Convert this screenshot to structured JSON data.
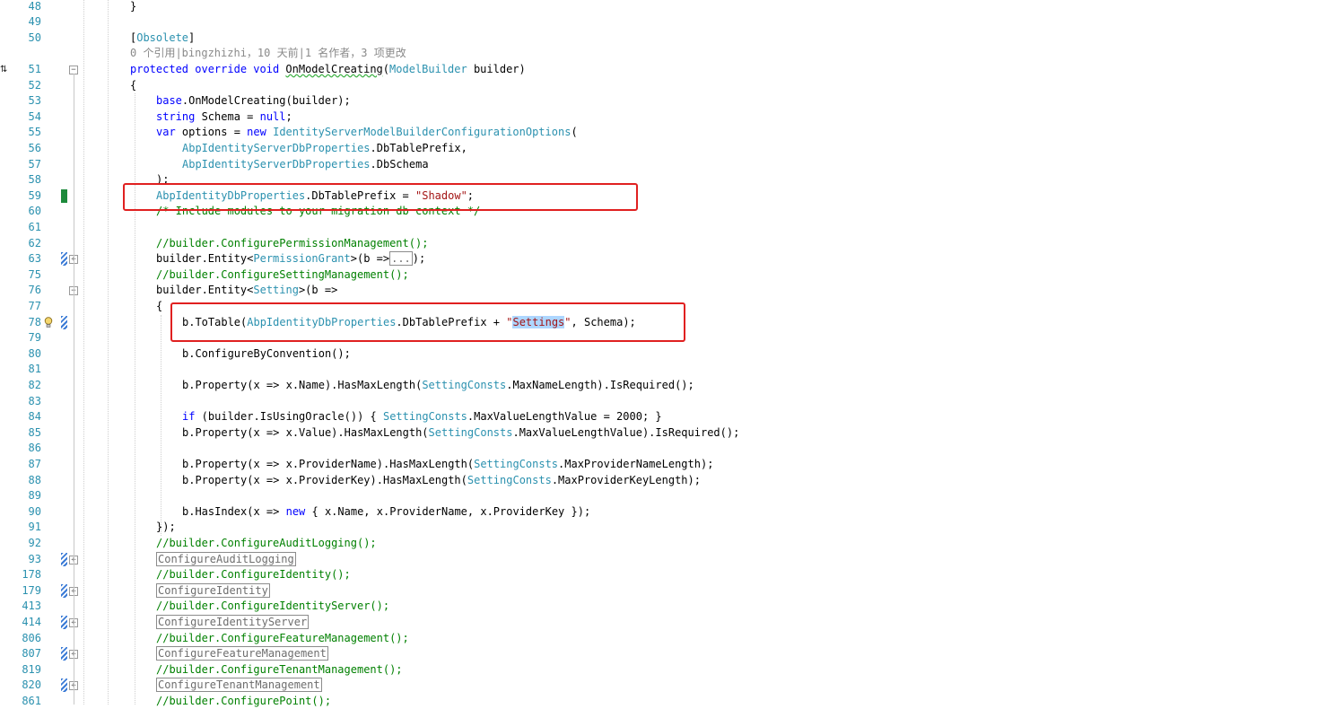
{
  "editor": {
    "language": "C#",
    "margin_marker": "⇅",
    "lines": [
      {
        "num": "48",
        "segs": [
          {
            "t": "}"
          }
        ],
        "indent": 0
      },
      {
        "num": "49",
        "segs": [],
        "indent": 0
      },
      {
        "num": "50",
        "segs": [
          {
            "t": "["
          },
          {
            "t": "Obsolete",
            "c": "att"
          },
          {
            "t": "]"
          }
        ],
        "indent": 0
      },
      {
        "num": "",
        "segs": [
          {
            "t": "0 个引用|bingzhizhi，10 天前|1 名作者，3 项更改",
            "c": "lens"
          }
        ],
        "indent": 0,
        "lens": true
      },
      {
        "num": "51",
        "segs": [
          {
            "t": "protected override void",
            "c": "kw"
          },
          {
            "t": " "
          },
          {
            "t": "OnModelCreating",
            "c": "wavy"
          },
          {
            "t": "("
          },
          {
            "t": "ModelBuilder",
            "c": "ty"
          },
          {
            "t": " builder)"
          }
        ],
        "indent": 0,
        "fold": "minus"
      },
      {
        "num": "52",
        "segs": [
          {
            "t": "{"
          }
        ],
        "indent": 0
      },
      {
        "num": "53",
        "segs": [
          {
            "t": "base",
            "c": "kw"
          },
          {
            "t": ".OnModelCreating(builder);"
          }
        ],
        "indent": 1
      },
      {
        "num": "54",
        "segs": [
          {
            "t": "string",
            "c": "kw"
          },
          {
            "t": " Schema = "
          },
          {
            "t": "null",
            "c": "kw"
          },
          {
            "t": ";"
          }
        ],
        "indent": 1
      },
      {
        "num": "55",
        "segs": [
          {
            "t": "var",
            "c": "kw"
          },
          {
            "t": " options = "
          },
          {
            "t": "new",
            "c": "kw"
          },
          {
            "t": " "
          },
          {
            "t": "IdentityServerModelBuilderConfigurationOptions",
            "c": "ty"
          },
          {
            "t": "("
          }
        ],
        "indent": 1
      },
      {
        "num": "56",
        "segs": [
          {
            "t": "AbpIdentityServerDbProperties",
            "c": "ty"
          },
          {
            "t": ".DbTablePrefix,"
          }
        ],
        "indent": 2
      },
      {
        "num": "57",
        "segs": [
          {
            "t": "AbpIdentityServerDbProperties",
            "c": "ty"
          },
          {
            "t": ".DbSchema"
          }
        ],
        "indent": 2
      },
      {
        "num": "58",
        "segs": [
          {
            "t": ");"
          }
        ],
        "indent": 1
      },
      {
        "num": "59",
        "segs": [
          {
            "t": "AbpIdentityDbProperties",
            "c": "ty"
          },
          {
            "t": ".DbTablePrefix = "
          },
          {
            "t": "\"Shadow\"",
            "c": "st"
          },
          {
            "t": ";"
          }
        ],
        "indent": 1,
        "gutter": "saved"
      },
      {
        "num": "60",
        "segs": [
          {
            "t": "/* Include modules to your migration db context */",
            "c": "cm"
          }
        ],
        "indent": 1
      },
      {
        "num": "61",
        "segs": [],
        "indent": 0
      },
      {
        "num": "62",
        "segs": [
          {
            "t": "//builder.ConfigurePermissionManagement();",
            "c": "cm"
          }
        ],
        "indent": 1
      },
      {
        "num": "63",
        "segs": [
          {
            "t": "builder.Entity<"
          },
          {
            "t": "PermissionGrant",
            "c": "ty"
          },
          {
            "t": ">(b =>"
          },
          {
            "t": "...",
            "c": "coll"
          },
          {
            "t": ");"
          }
        ],
        "indent": 1,
        "fold": "plus",
        "gutter": "chg"
      },
      {
        "num": "75",
        "segs": [
          {
            "t": "//builder.ConfigureSettingManagement();",
            "c": "cm"
          }
        ],
        "indent": 1
      },
      {
        "num": "76",
        "segs": [
          {
            "t": "builder.Entity<"
          },
          {
            "t": "Setting",
            "c": "ty"
          },
          {
            "t": ">(b =>"
          }
        ],
        "indent": 1,
        "fold": "minus"
      },
      {
        "num": "77",
        "segs": [
          {
            "t": "{"
          }
        ],
        "indent": 1
      },
      {
        "num": "78",
        "segs": [
          {
            "t": "b.ToTable("
          },
          {
            "t": "AbpIdentityDbProperties",
            "c": "ty"
          },
          {
            "t": ".DbTablePrefix + "
          },
          {
            "t": "\"",
            "c": "st"
          },
          {
            "t": "Settings",
            "c": "st hl"
          },
          {
            "t": "\"",
            "c": "st"
          },
          {
            "t": ", Schema);"
          }
        ],
        "indent": 2,
        "gutter": "chg",
        "bulb": true
      },
      {
        "num": "79",
        "segs": [],
        "indent": 0
      },
      {
        "num": "80",
        "segs": [
          {
            "t": "b.ConfigureByConvention();"
          }
        ],
        "indent": 2
      },
      {
        "num": "81",
        "segs": [],
        "indent": 0
      },
      {
        "num": "82",
        "segs": [
          {
            "t": "b.Property(x => x.Name).HasMaxLength("
          },
          {
            "t": "SettingConsts",
            "c": "ty"
          },
          {
            "t": ".MaxNameLength).IsRequired();"
          }
        ],
        "indent": 2
      },
      {
        "num": "83",
        "segs": [],
        "indent": 0
      },
      {
        "num": "84",
        "segs": [
          {
            "t": "if",
            "c": "kw"
          },
          {
            "t": " (builder.IsUsingOracle()) { "
          },
          {
            "t": "SettingConsts",
            "c": "ty"
          },
          {
            "t": ".MaxValueLengthValue = 2000; }"
          }
        ],
        "indent": 2
      },
      {
        "num": "85",
        "segs": [
          {
            "t": "b.Property(x => x.Value).HasMaxLength("
          },
          {
            "t": "SettingConsts",
            "c": "ty"
          },
          {
            "t": ".MaxValueLengthValue).IsRequired();"
          }
        ],
        "indent": 2
      },
      {
        "num": "86",
        "segs": [],
        "indent": 0
      },
      {
        "num": "87",
        "segs": [
          {
            "t": "b.Property(x => x.ProviderName).HasMaxLength("
          },
          {
            "t": "SettingConsts",
            "c": "ty"
          },
          {
            "t": ".MaxProviderNameLength);"
          }
        ],
        "indent": 2
      },
      {
        "num": "88",
        "segs": [
          {
            "t": "b.Property(x => x.ProviderKey).HasMaxLength("
          },
          {
            "t": "SettingConsts",
            "c": "ty"
          },
          {
            "t": ".MaxProviderKeyLength);"
          }
        ],
        "indent": 2
      },
      {
        "num": "89",
        "segs": [],
        "indent": 0
      },
      {
        "num": "90",
        "segs": [
          {
            "t": "b.HasIndex(x => "
          },
          {
            "t": "new",
            "c": "kw"
          },
          {
            "t": " { x.Name, x.ProviderName, x.ProviderKey });"
          }
        ],
        "indent": 2
      },
      {
        "num": "91",
        "segs": [
          {
            "t": "});"
          }
        ],
        "indent": 1
      },
      {
        "num": "92",
        "segs": [
          {
            "t": "//builder.ConfigureAuditLogging();",
            "c": "cm"
          }
        ],
        "indent": 1
      },
      {
        "num": "93",
        "segs": [
          {
            "t": "ConfigureAuditLogging",
            "c": "coll"
          }
        ],
        "indent": 1,
        "fold": "plus",
        "gutter": "chg"
      },
      {
        "num": "178",
        "segs": [
          {
            "t": "//builder.ConfigureIdentity();",
            "c": "cm"
          }
        ],
        "indent": 1
      },
      {
        "num": "179",
        "segs": [
          {
            "t": "ConfigureIdentity",
            "c": "coll"
          }
        ],
        "indent": 1,
        "fold": "plus",
        "gutter": "chg"
      },
      {
        "num": "413",
        "segs": [
          {
            "t": "//builder.ConfigureIdentityServer();",
            "c": "cm"
          }
        ],
        "indent": 1
      },
      {
        "num": "414",
        "segs": [
          {
            "t": "ConfigureIdentityServer",
            "c": "coll"
          }
        ],
        "indent": 1,
        "fold": "plus",
        "gutter": "chg"
      },
      {
        "num": "806",
        "segs": [
          {
            "t": "//builder.ConfigureFeatureManagement();",
            "c": "cm"
          }
        ],
        "indent": 1
      },
      {
        "num": "807",
        "segs": [
          {
            "t": "ConfigureFeatureManagement",
            "c": "coll"
          }
        ],
        "indent": 1,
        "fold": "plus",
        "gutter": "chg"
      },
      {
        "num": "819",
        "segs": [
          {
            "t": "//builder.ConfigureTenantManagement();",
            "c": "cm"
          }
        ],
        "indent": 1
      },
      {
        "num": "820",
        "segs": [
          {
            "t": "ConfigureTenantManagement",
            "c": "coll"
          }
        ],
        "indent": 1,
        "fold": "plus",
        "gutter": "chg"
      },
      {
        "num": "861",
        "segs": [
          {
            "t": "//builder.ConfigurePoint();",
            "c": "cm"
          }
        ],
        "indent": 1
      }
    ]
  },
  "colors": {
    "keyword": "#0000ff",
    "type": "#2b91af",
    "comment": "#008000",
    "string": "#a31515",
    "line_number": "#2b91af",
    "annotation_box": "#e02020",
    "selection": "#add6ff"
  }
}
